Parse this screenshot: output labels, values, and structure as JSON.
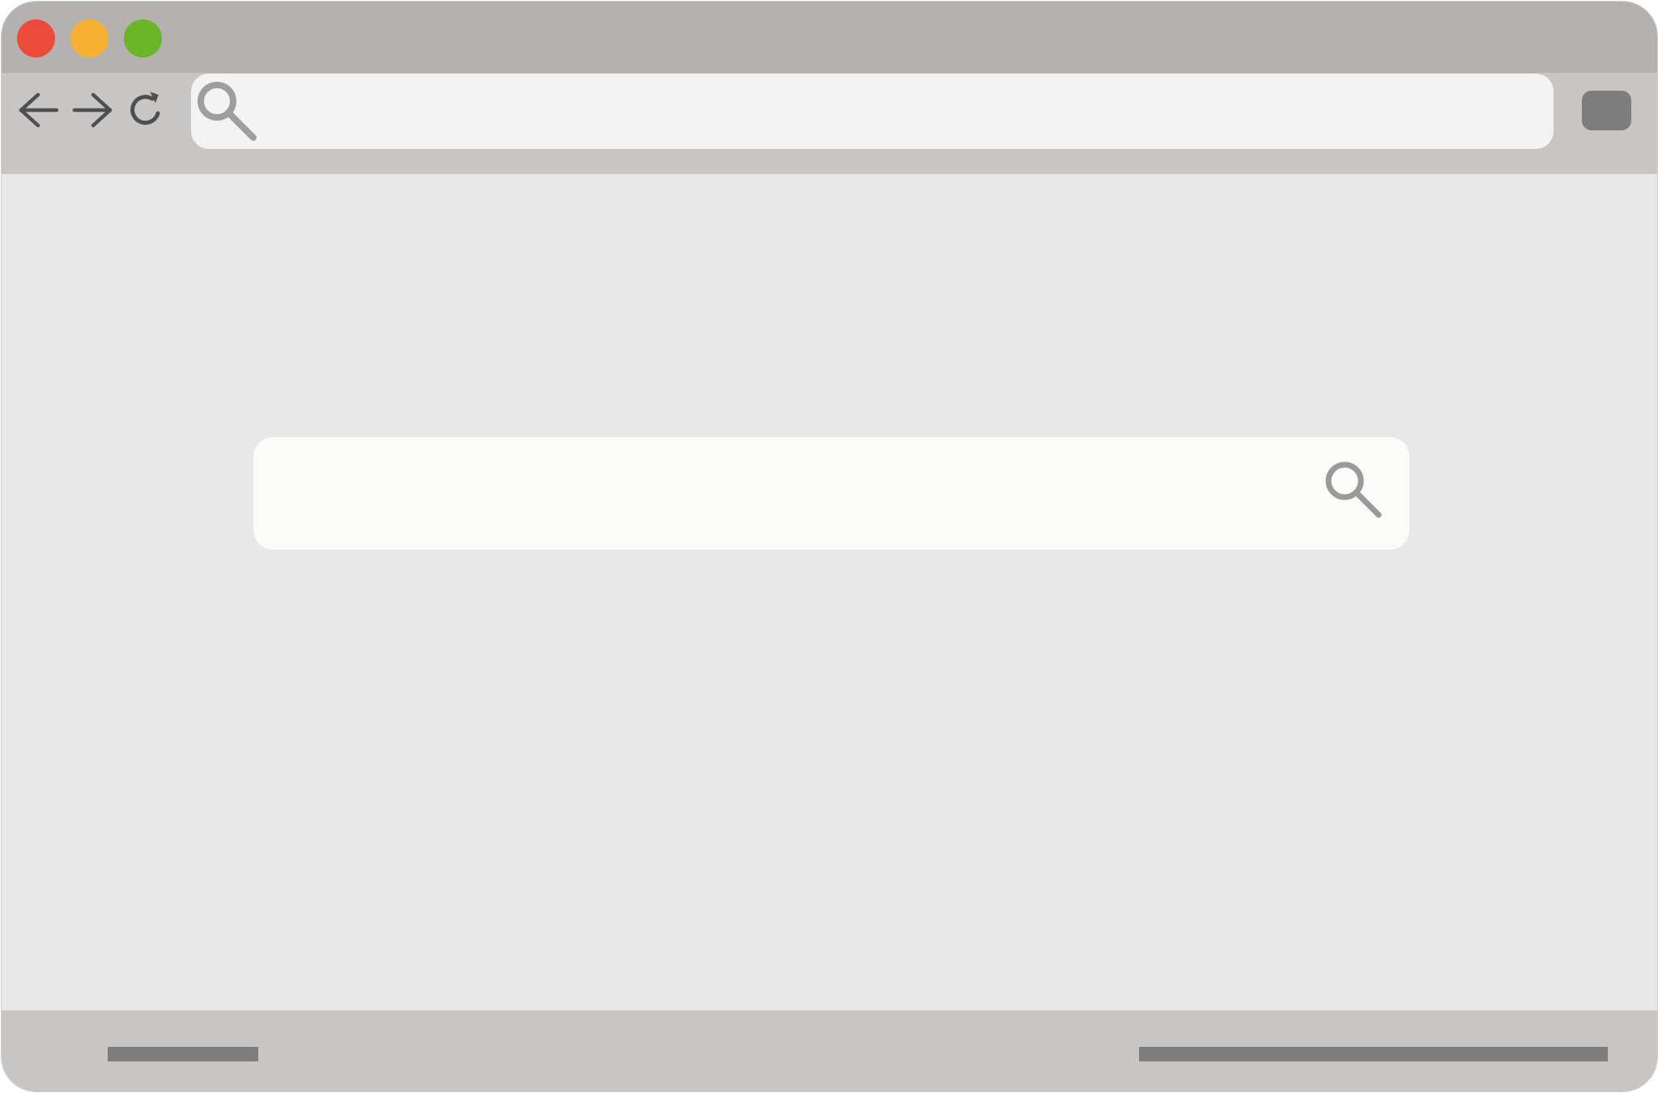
{
  "window": {
    "traffic_lights": [
      {
        "name": "close",
        "color": "#ec4b3c"
      },
      {
        "name": "minimize",
        "color": "#f7b233"
      },
      {
        "name": "maximize",
        "color": "#6bb52a"
      }
    ]
  },
  "toolbar": {
    "back_icon": "arrow-left-icon",
    "forward_icon": "arrow-right-icon",
    "reload_icon": "reload-icon",
    "menu_icon": "menu-button",
    "icon_color": "#4f4f4f"
  },
  "address_bar": {
    "value": "",
    "placeholder": "",
    "icon": "search-icon",
    "icon_color": "#9e9e9e"
  },
  "main": {
    "search": {
      "value": "",
      "placeholder": "",
      "icon": "search-icon",
      "icon_color": "#9a9a9a"
    }
  },
  "status_bar": {
    "left_indicator": "status-bar-left",
    "right_indicator": "status-bar-right",
    "indicator_color": "#7e7d7e"
  }
}
